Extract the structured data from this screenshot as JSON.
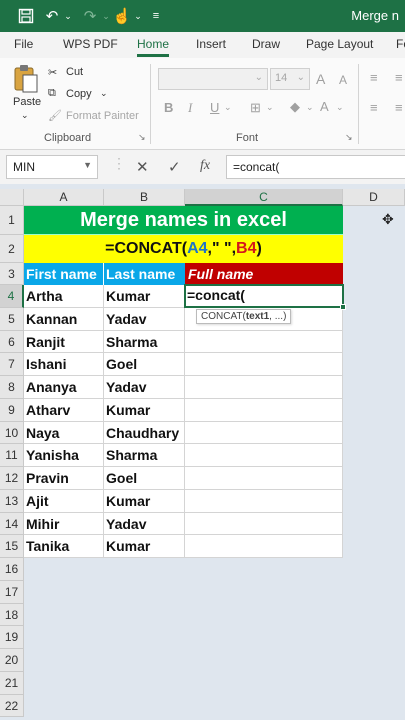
{
  "window": {
    "title": "Merge n"
  },
  "quick_access": {
    "save_icon": "save-icon",
    "undo_icon": "undo-icon",
    "redo_icon": "redo-icon",
    "touch_icon": "touch-mode-icon",
    "customize_icon": "customize-icon"
  },
  "ribbon": {
    "tabs": [
      {
        "label": "File"
      },
      {
        "label": "WPS PDF"
      },
      {
        "label": "Home"
      },
      {
        "label": "Insert"
      },
      {
        "label": "Draw"
      },
      {
        "label": "Page Layout"
      },
      {
        "label": "Fo"
      }
    ],
    "active_tab": "Home",
    "clipboard": {
      "paste": "Paste",
      "cut": "Cut",
      "copy": "Copy",
      "format_painter": "Format Painter",
      "group_label": "Clipboard"
    },
    "font": {
      "size": "14",
      "grow": "A",
      "shrink": "A",
      "bold": "B",
      "italic": "I",
      "underline": "U",
      "group_label": "Font"
    }
  },
  "formula_bar": {
    "name_box": "MIN",
    "cancel": "✕",
    "enter": "✓",
    "fx": "fx",
    "content": "=concat("
  },
  "sheet": {
    "columns": [
      "A",
      "B",
      "C",
      "D"
    ],
    "selected_column": "C",
    "rows": [
      "1",
      "2",
      "3",
      "4",
      "5",
      "6",
      "7",
      "8",
      "9",
      "10",
      "11",
      "12",
      "13",
      "14",
      "15",
      "16",
      "17",
      "18",
      "19",
      "20",
      "21",
      "22"
    ],
    "selected_row": "4",
    "title": "Merge names in excel",
    "formula_parts": {
      "pre": "=CONCAT(",
      "a": "A4",
      "mid": ",\" \",",
      "b": "B4",
      "post": ")"
    },
    "headers": {
      "first": "First name",
      "last": "Last name",
      "full": "Full name"
    },
    "active_cell_text": "=concat(",
    "tooltip": {
      "func": "CONCAT(",
      "arg": "text1",
      "rest": ", ...)"
    },
    "data": [
      {
        "first": "Artha",
        "last": "Kumar"
      },
      {
        "first": "Kannan",
        "last": "Yadav"
      },
      {
        "first": "Ranjit",
        "last": "Sharma"
      },
      {
        "first": "Ishani",
        "last": "Goel"
      },
      {
        "first": "Ananya",
        "last": "Yadav"
      },
      {
        "first": "Atharv",
        "last": "Kumar"
      },
      {
        "first": "Naya",
        "last": "Chaudhary"
      },
      {
        "first": "Yanisha",
        "last": "Sharma"
      },
      {
        "first": "Pravin",
        "last": "Goel"
      },
      {
        "first": "Ajit",
        "last": "Kumar"
      },
      {
        "first": "Mihir",
        "last": "Yadav"
      },
      {
        "first": "Tanika",
        "last": "Kumar"
      }
    ]
  },
  "colors": {
    "excel_green": "#1e7145",
    "title_green": "#00b050",
    "formula_yellow": "#ffff00",
    "header_blue": "#0aa7e8",
    "header_red": "#c00000"
  }
}
